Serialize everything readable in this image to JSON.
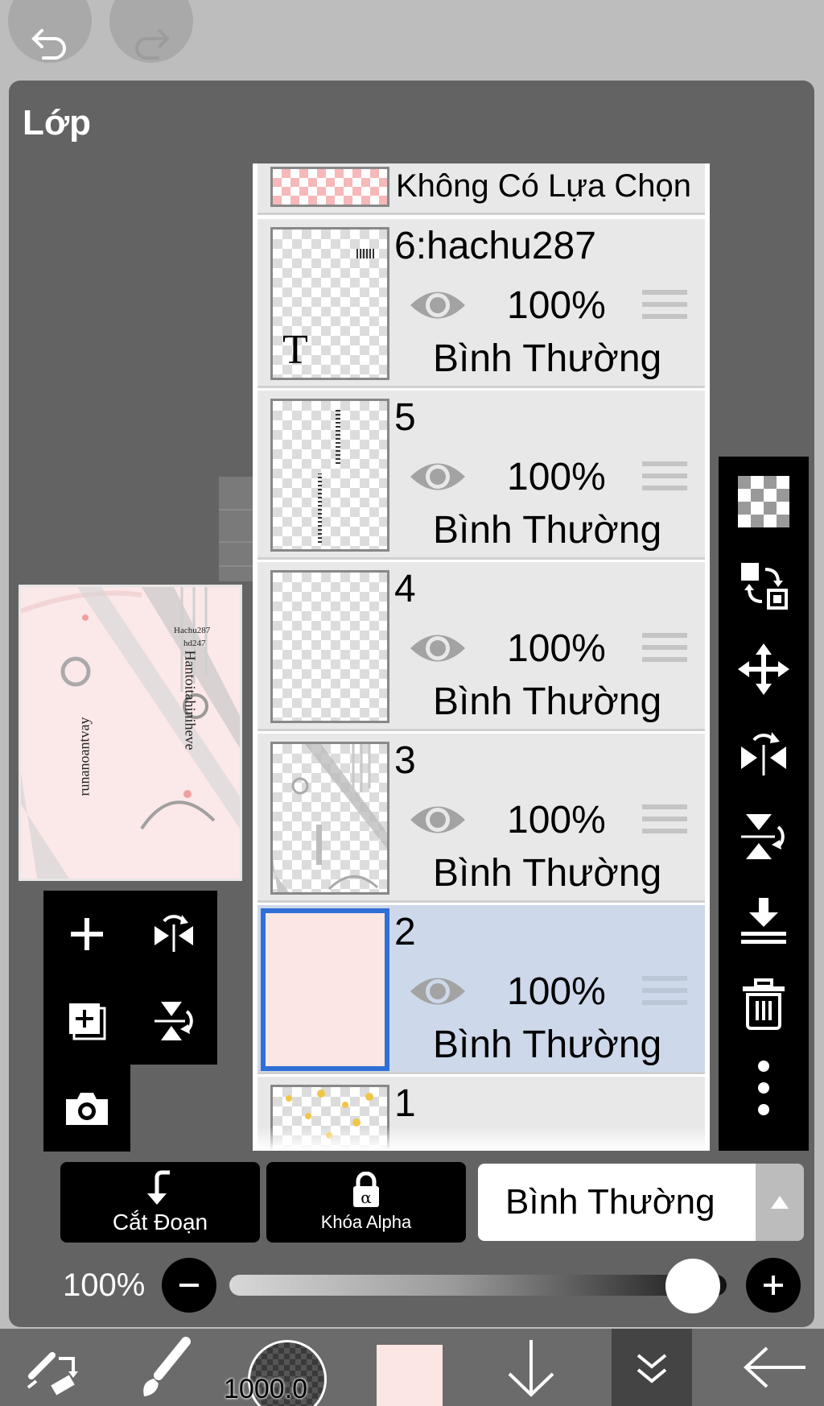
{
  "panel": {
    "title": "Lớp"
  },
  "preview": {
    "text_lines": [
      "Hachu287",
      "hd247"
    ],
    "vertical_text_1": "Hantoitahiniheve",
    "vertical_text_2": "runanoantvay"
  },
  "layers": [
    {
      "name": "Không Có Lựa Chọn",
      "kind": "selection"
    },
    {
      "name": "6:hachu287",
      "opacity": "100%",
      "blend": "Bình Thường",
      "type_badge": "T",
      "selected": false
    },
    {
      "name": "5",
      "opacity": "100%",
      "blend": "Bình Thường",
      "selected": false
    },
    {
      "name": "4",
      "opacity": "100%",
      "blend": "Bình Thường",
      "selected": false
    },
    {
      "name": "3",
      "opacity": "100%",
      "blend": "Bình Thường",
      "selected": false
    },
    {
      "name": "2",
      "opacity": "100%",
      "blend": "Bình Thường",
      "selected": true
    },
    {
      "name": "1"
    }
  ],
  "bottom_buttons": {
    "clip": "Cắt Đoạn",
    "alpha_lock": "Khóa Alpha"
  },
  "blend_mode": {
    "value": "Bình Thường"
  },
  "opacity": {
    "label": "100%",
    "value": 1.0
  },
  "toolbar": {
    "brush_size": "1000.0"
  },
  "colors": {
    "accent": "#2f6fd6",
    "panel_bg": "#636363",
    "selected_row": "#cdd8ea",
    "canvas_pink": "#fbe7e7"
  },
  "icons": {
    "left_tools": [
      "plus-icon",
      "flip-horizontal-icon",
      "add-layer-icon",
      "flip-vertical-icon",
      "camera-icon"
    ],
    "right_tools": [
      "transparent-bg-icon",
      "swap-layer-icon",
      "move-icon",
      "flip-horizontal-icon",
      "flip-vertical-icon",
      "merge-down-icon",
      "trash-icon",
      "more-icon"
    ],
    "bottom_bar": [
      "transform-icon",
      "brush-icon",
      "brush-size-icon",
      "color-swatch-icon",
      "arrow-down-icon",
      "collapse-icon",
      "back-icon"
    ]
  }
}
